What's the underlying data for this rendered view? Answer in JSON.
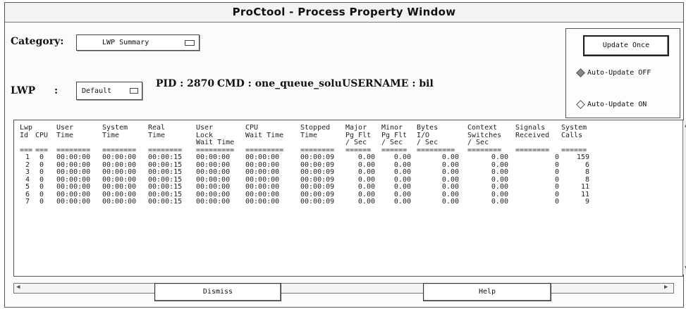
{
  "window": {
    "title": "ProCtool - Process Property Window"
  },
  "category": {
    "label": "Category:",
    "value": "LWP Summary"
  },
  "lwp": {
    "label": "LWP",
    "colon": ":",
    "value": "Default"
  },
  "info": {
    "pid": "PID : 2870",
    "cmd": "CMD : one_queue_solu",
    "username": "USERNAME : bil"
  },
  "controls": {
    "update_once": "Update Once",
    "auto_off": "Auto-Update OFF",
    "auto_on": "Auto-Update ON",
    "selected": "auto_off"
  },
  "table": {
    "header_lines": [
      [
        "Lwp",
        "",
        "User",
        "System",
        "Real",
        "User",
        "CPU",
        "Stopped",
        "Major",
        "Minor",
        "Bytes",
        "Context",
        "Signals",
        "System"
      ],
      [
        "Id",
        "CPU",
        "Time",
        "Time",
        "Time",
        "Lock",
        "Wait Time",
        "Time",
        "Pg Flt",
        "Pg Flt",
        "I/O",
        "Switches",
        "Received",
        "Calls"
      ],
      [
        "",
        "",
        "",
        "",
        "",
        "Wait Time",
        "",
        "",
        "/ Sec",
        "/ Sec",
        "/ Sec",
        "/ Sec",
        "",
        ""
      ]
    ],
    "separators": [
      "===",
      "===",
      "========",
      "========",
      "========",
      "=========",
      "=========",
      "========",
      "======",
      "======",
      "=========",
      "========",
      "========",
      "======"
    ],
    "rows": [
      [
        "1",
        "0",
        "00:00:00",
        "00:00:00",
        "00:00:15",
        "00:00:00",
        "00:00:00",
        "00:00:09",
        "0.00",
        "0.00",
        "0.00",
        "0.00",
        "0",
        "159"
      ],
      [
        "2",
        "0",
        "00:00:00",
        "00:00:00",
        "00:00:15",
        "00:00:00",
        "00:00:00",
        "00:00:09",
        "0.00",
        "0.00",
        "0.00",
        "0.00",
        "0",
        "6"
      ],
      [
        "3",
        "0",
        "00:00:00",
        "00:00:00",
        "00:00:15",
        "00:00:00",
        "00:00:00",
        "00:00:09",
        "0.00",
        "0.00",
        "0.00",
        "0.00",
        "0",
        "8"
      ],
      [
        "4",
        "0",
        "00:00:00",
        "00:00:00",
        "00:00:15",
        "00:00:00",
        "00:00:00",
        "00:00:09",
        "0.00",
        "0.00",
        "0.00",
        "0.00",
        "0",
        "8"
      ],
      [
        "5",
        "0",
        "00:00:00",
        "00:00:00",
        "00:00:15",
        "00:00:00",
        "00:00:00",
        "00:00:09",
        "0.00",
        "0.00",
        "0.00",
        "0.00",
        "0",
        "11"
      ],
      [
        "6",
        "0",
        "00:00:00",
        "00:00:00",
        "00:00:15",
        "00:00:00",
        "00:00:00",
        "00:00:09",
        "0.00",
        "0.00",
        "0.00",
        "0.00",
        "0",
        "11"
      ],
      [
        "7",
        "0",
        "00:00:00",
        "00:00:00",
        "00:00:15",
        "00:00:00",
        "00:00:00",
        "00:00:09",
        "0.00",
        "0.00",
        "0.00",
        "0.00",
        "0",
        "9"
      ]
    ]
  },
  "buttons": {
    "dismiss": "Dismiss",
    "help": "Help"
  },
  "icons": {
    "menu_glyph": "option-menu-icon",
    "scroll_up": "arrow-up-icon",
    "scroll_down": "arrow-down-icon",
    "scroll_left": "arrow-left-icon",
    "scroll_right": "arrow-right-icon"
  }
}
